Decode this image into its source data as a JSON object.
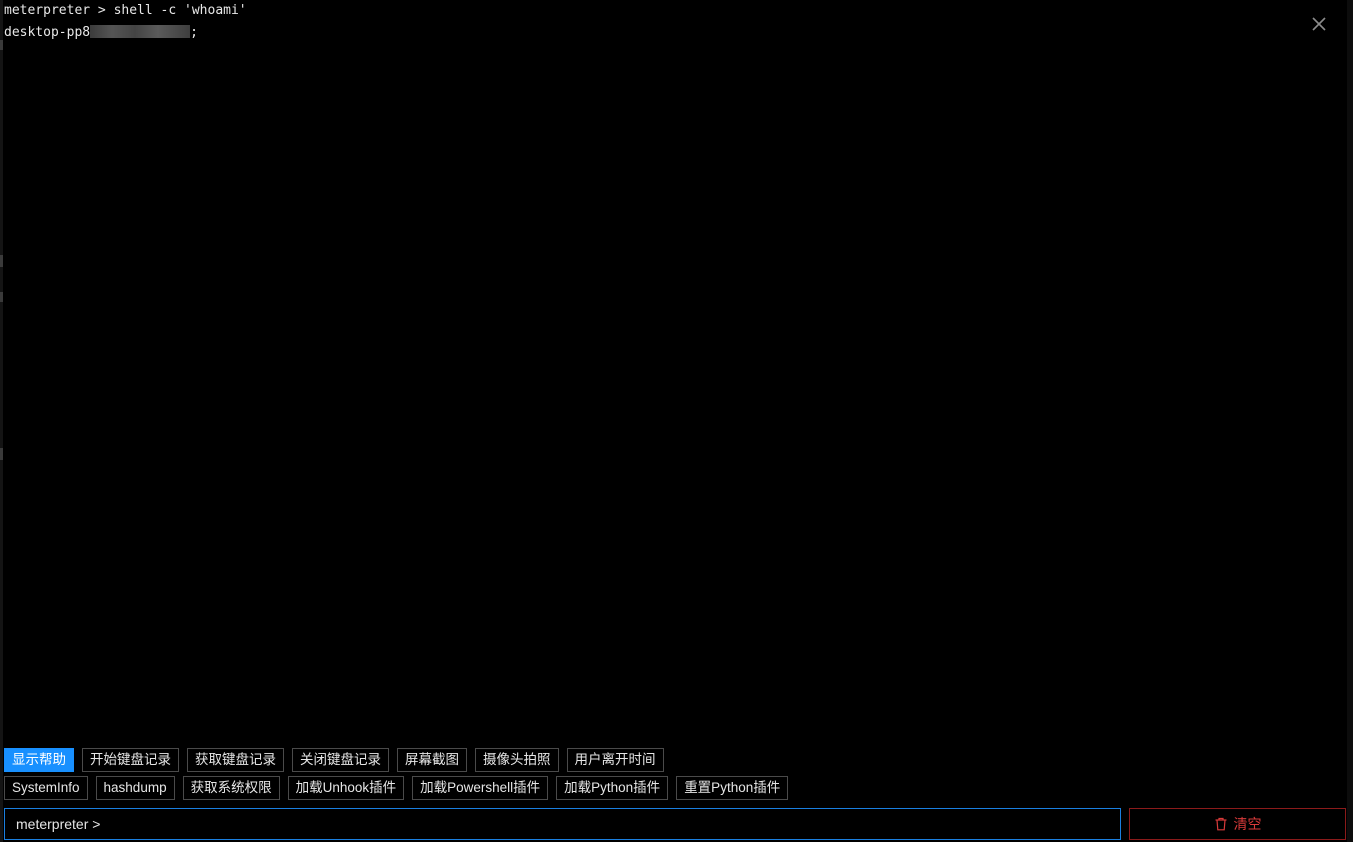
{
  "terminal": {
    "lines": [
      {
        "text": "meterpreter > shell -c 'whoami'"
      },
      {
        "text_visible": "desktop-pp8",
        "suffix": ";"
      }
    ]
  },
  "quick_buttons": {
    "row1": [
      {
        "label": "显示帮助",
        "primary": true
      },
      {
        "label": "开始键盘记录"
      },
      {
        "label": "获取键盘记录"
      },
      {
        "label": "关闭键盘记录"
      },
      {
        "label": "屏幕截图"
      },
      {
        "label": "摄像头拍照"
      },
      {
        "label": "用户离开时间"
      }
    ],
    "row2": [
      {
        "label": "SystemInfo"
      },
      {
        "label": "hashdump"
      },
      {
        "label": "获取系统权限"
      },
      {
        "label": "加载Unhook插件"
      },
      {
        "label": "加载Powershell插件"
      },
      {
        "label": "加载Python插件"
      },
      {
        "label": "重置Python插件"
      }
    ]
  },
  "command_input": {
    "prefix": "meterpreter >",
    "value": ""
  },
  "clear_button": {
    "label": "清空"
  },
  "icons": {
    "close": "close-icon",
    "clear": "trash-icon"
  },
  "colors": {
    "background": "#000000",
    "primary": "#1890ff",
    "danger": "#d83a3a",
    "danger_border": "#8b1a1a",
    "input_border": "#1a7fe0"
  }
}
